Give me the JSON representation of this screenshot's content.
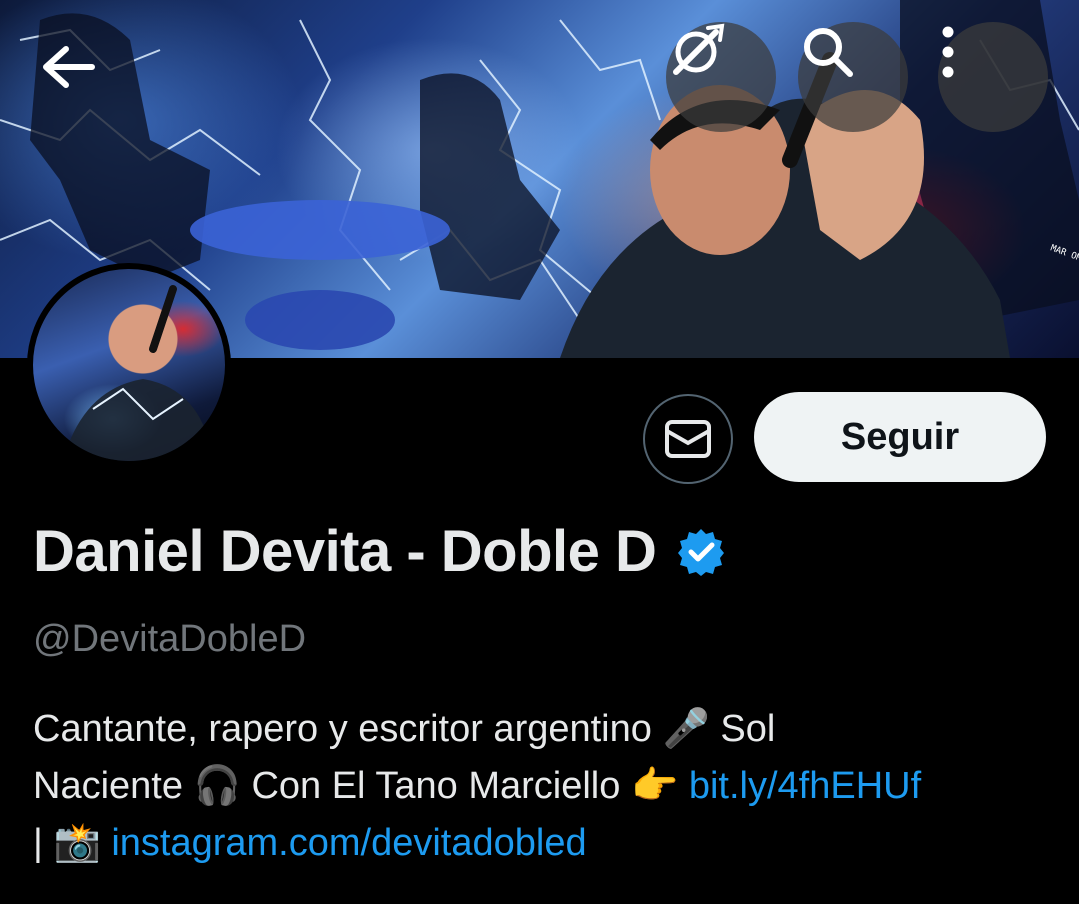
{
  "header": {
    "back_icon": "arrow-left-icon",
    "grok_icon": "grok-icon",
    "search_icon": "search-icon",
    "more_icon": "more-vertical-icon"
  },
  "banner": {
    "artist_signature": "MAR OM DIMENEZ"
  },
  "actions": {
    "message_icon": "envelope-icon",
    "follow_label": "Seguir"
  },
  "profile": {
    "display_name": "Daniel Devita - Doble D",
    "verified": true,
    "verified_color": "#1d9bf0",
    "handle": "@DevitaDobleD"
  },
  "bio": {
    "line1_text": "Cantante, rapero y escritor argentino",
    "line1_emoji": "🎤",
    "line1_tail": "Sol",
    "line2_text": "Naciente",
    "line2_emoji1": "🎧",
    "line2_mid": "Con El Tano Marciello",
    "line2_emoji2": "👉",
    "line2_link": "bit.ly/4fhEHUf",
    "line3_sep": "|",
    "line3_emoji": "📸",
    "line3_link": "instagram.com/devitadobled"
  },
  "colors": {
    "background": "#000000",
    "link": "#1d9bf0",
    "secondary_text": "#71767b",
    "button_bg": "#eff3f4"
  }
}
